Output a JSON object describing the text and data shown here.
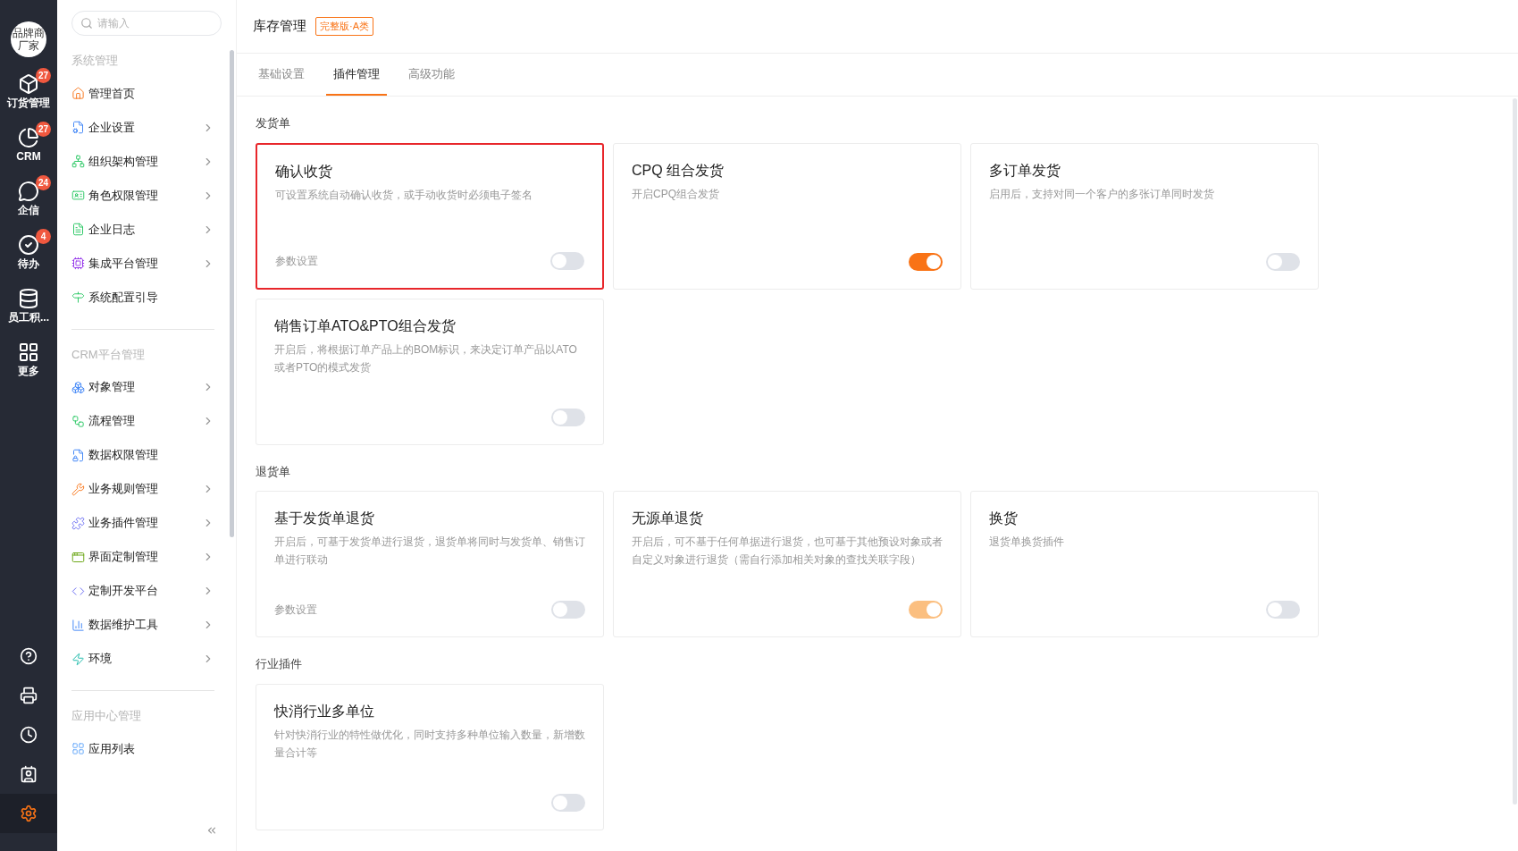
{
  "rail": {
    "avatar": "品牌商厂家",
    "items": [
      {
        "label": "订货管理",
        "badge": "27"
      },
      {
        "label": "CRM",
        "badge": "27"
      },
      {
        "label": "企信",
        "badge": "24"
      },
      {
        "label": "待办",
        "badge": "4"
      },
      {
        "label": "员工积..."
      },
      {
        "label": "更多"
      }
    ],
    "bottom_items": [
      {
        "selected": false
      },
      {
        "selected": false
      },
      {
        "selected": false
      },
      {
        "selected": false
      },
      {
        "selected": true
      }
    ]
  },
  "sidebar": {
    "search": {
      "placeholder": "请输入"
    },
    "groups": [
      {
        "title": "系统管理",
        "items": [
          {
            "label": "管理首页",
            "expandable": false
          },
          {
            "label": "企业设置",
            "expandable": true
          },
          {
            "label": "组织架构管理",
            "expandable": true
          },
          {
            "label": "角色权限管理",
            "expandable": true
          },
          {
            "label": "企业日志",
            "expandable": true
          },
          {
            "label": "集成平台管理",
            "expandable": true
          },
          {
            "label": "系统配置引导",
            "expandable": false
          }
        ]
      },
      {
        "title": "CRM平台管理",
        "items": [
          {
            "label": "对象管理",
            "expandable": true
          },
          {
            "label": "流程管理",
            "expandable": true
          },
          {
            "label": "数据权限管理",
            "expandable": false
          },
          {
            "label": "业务规则管理",
            "expandable": true
          },
          {
            "label": "业务插件管理",
            "expandable": true
          },
          {
            "label": "界面定制管理",
            "expandable": true
          },
          {
            "label": "定制开发平台",
            "expandable": true
          },
          {
            "label": "数据维护工具",
            "expandable": true
          },
          {
            "label": "环境",
            "expandable": true
          }
        ]
      },
      {
        "title": "应用中心管理",
        "items": [
          {
            "label": "应用列表",
            "expandable": false
          }
        ]
      }
    ]
  },
  "header": {
    "title": "库存管理",
    "badge": "完整版·A类"
  },
  "tabs": [
    {
      "label": "基础设置",
      "selected": false
    },
    {
      "label": "插件管理",
      "selected": true
    },
    {
      "label": "高级功能",
      "selected": false
    }
  ],
  "sections": [
    {
      "title": "发货单",
      "cards": [
        {
          "title": "确认收货",
          "description": "可设置系统自动确认收货，或手动收货时必须电子签名",
          "link": "参数设置",
          "on": false,
          "disabled": false,
          "highlighted": true
        },
        {
          "title": "CPQ 组合发货",
          "description": "开启CPQ组合发货",
          "on": true,
          "disabled": false,
          "highlighted": false
        },
        {
          "title": "多订单发货",
          "description": "启用后，支持对同一个客户的多张订单同时发货",
          "on": false,
          "disabled": false,
          "highlighted": false
        },
        {
          "title": "销售订单ATO&PTO组合发货",
          "description": "开启后，将根据订单产品上的BOM标识，来决定订单产品以ATO或者PTO的模式发货",
          "on": false,
          "disabled": false,
          "highlighted": false
        }
      ]
    },
    {
      "title": "退货单",
      "cards": [
        {
          "title": "基于发货单退货",
          "description": "开启后，可基于发货单进行退货，退货单将同时与发货单、销售订单进行联动",
          "link": "参数设置",
          "on": false,
          "disabled": false,
          "highlighted": false
        },
        {
          "title": "无源单退货",
          "description": "开启后，可不基于任何单据进行退货，也可基于其他预设对象或者自定义对象进行退货（需自行添加相关对象的查找关联字段）",
          "on": true,
          "disabled": true,
          "highlighted": false
        },
        {
          "title": "换货",
          "description": "退货单换货插件",
          "on": false,
          "disabled": false,
          "highlighted": false
        }
      ]
    },
    {
      "title": "行业插件",
      "cards": [
        {
          "title": "快消行业多单位",
          "description": "针对快消行业的特性做优化，同时支持多种单位输入数量，新增数量合计等",
          "on": false,
          "disabled": false,
          "highlighted": false
        }
      ]
    }
  ]
}
